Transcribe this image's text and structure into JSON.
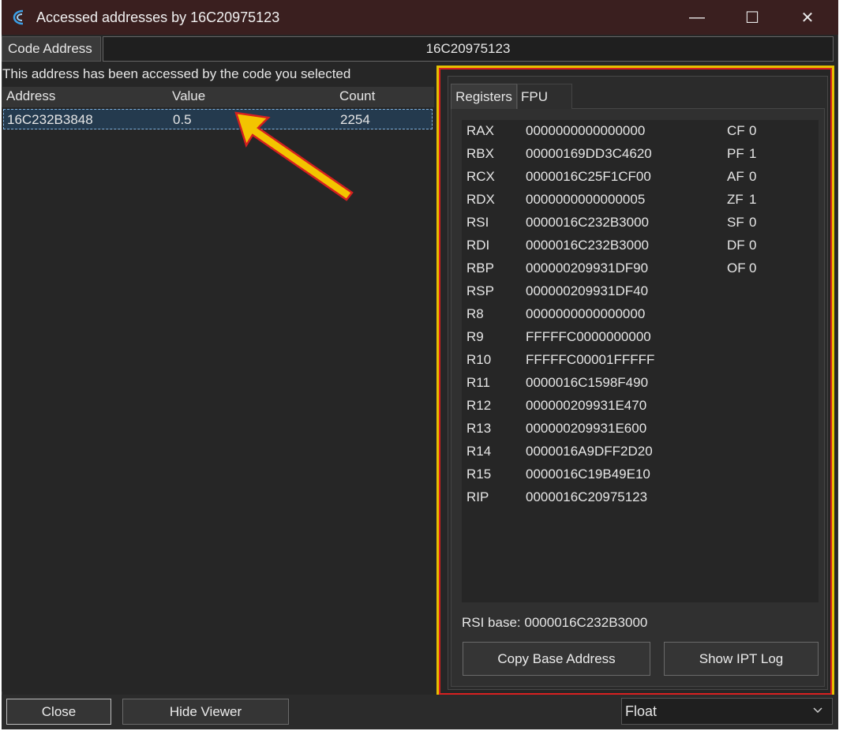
{
  "window": {
    "title": "Accessed addresses by 16C20975123",
    "controls": {
      "minimize": "—",
      "maximize": "☐",
      "close": "✕"
    }
  },
  "code_address": {
    "label": "Code Address",
    "value": "16C20975123"
  },
  "info_text": "This address has been accessed by the code you selected",
  "list": {
    "columns": [
      "Address",
      "Value",
      "Count"
    ],
    "rows": [
      {
        "address": "16C232B3848",
        "value": "0.5",
        "count": "2254"
      }
    ]
  },
  "tabs": {
    "registers": "Registers",
    "fpu": "FPU"
  },
  "registers": [
    {
      "name": "RAX",
      "value": "0000000000000000"
    },
    {
      "name": "RBX",
      "value": "00000169DD3C4620"
    },
    {
      "name": "RCX",
      "value": "0000016C25F1CF00"
    },
    {
      "name": "RDX",
      "value": "0000000000000005"
    },
    {
      "name": "RSI",
      "value": "0000016C232B3000"
    },
    {
      "name": "RDI",
      "value": "0000016C232B3000"
    },
    {
      "name": "RBP",
      "value": "000000209931DF90"
    },
    {
      "name": "RSP",
      "value": "000000209931DF40"
    },
    {
      "name": "R8",
      "value": "0000000000000000"
    },
    {
      "name": "R9",
      "value": "FFFFFC0000000000"
    },
    {
      "name": "R10",
      "value": "FFFFFC00001FFFFF"
    },
    {
      "name": "R11",
      "value": "0000016C1598F490"
    },
    {
      "name": "R12",
      "value": "000000209931E470"
    },
    {
      "name": "R13",
      "value": "000000209931E600"
    },
    {
      "name": "R14",
      "value": "0000016A9DFF2D20"
    },
    {
      "name": "R15",
      "value": "0000016C19B49E10"
    },
    {
      "name": "RIP",
      "value": "0000016C20975123"
    }
  ],
  "flags": [
    {
      "name": "CF",
      "value": "0"
    },
    {
      "name": "PF",
      "value": "1"
    },
    {
      "name": "AF",
      "value": "0"
    },
    {
      "name": "ZF",
      "value": "1"
    },
    {
      "name": "SF",
      "value": "0"
    },
    {
      "name": "DF",
      "value": "0"
    },
    {
      "name": "OF",
      "value": "0"
    }
  ],
  "rsi_base": "RSI base: 0000016C232B3000",
  "buttons": {
    "copy_base": "Copy Base Address",
    "show_ipt": "Show IPT Log",
    "close": "Close",
    "hide_viewer": "Hide Viewer"
  },
  "type_select": {
    "value": "Float"
  },
  "colors": {
    "highlight_outer": "#e5c000",
    "highlight_inner": "#d82020",
    "arrow_fill": "#f3c400",
    "arrow_outline": "#d42020"
  }
}
